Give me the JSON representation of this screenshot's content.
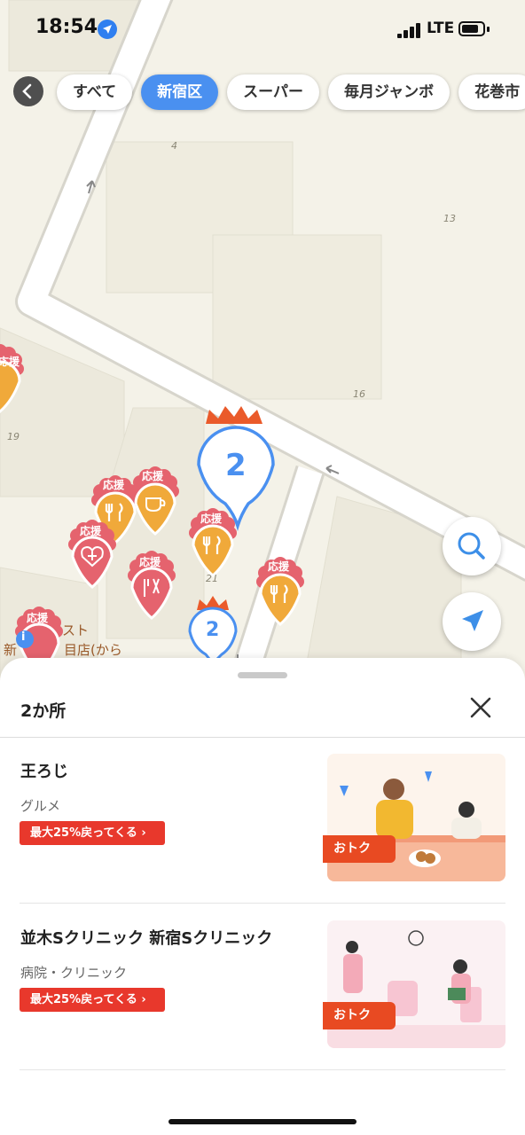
{
  "status": {
    "time": "18:54",
    "network": "LTE"
  },
  "filters": {
    "chips": [
      {
        "label": "すべて",
        "active": false
      },
      {
        "label": "新宿区",
        "active": true
      },
      {
        "label": "スーパー",
        "active": false
      },
      {
        "label": "毎月ジャンボ",
        "active": false
      },
      {
        "label": "花巻市",
        "active": false
      }
    ]
  },
  "map": {
    "block_numbers": [
      "4",
      "13",
      "16",
      "19",
      "21"
    ],
    "pin_label": "応援",
    "cluster_counts": [
      "2",
      "2"
    ],
    "place_label_line1": "スト",
    "place_label_line2": "目店(から",
    "place_label_prefix": "新"
  },
  "sheet": {
    "title": "2か所",
    "items": [
      {
        "name": "王ろじ",
        "category": "グルメ",
        "badge": "最大25%戻ってくる ›",
        "thumb_tag": "おトク"
      },
      {
        "name": "並木Sクリニック 新宿Sクリニック",
        "category": "病院・クリニック",
        "badge": "最大25%戻ってくる ›",
        "thumb_tag": "おトク"
      }
    ]
  },
  "colors": {
    "accent": "#4a90f0",
    "badge": "#e8382c",
    "pin_orange": "#f0a93a",
    "pin_red": "#e5636e"
  }
}
